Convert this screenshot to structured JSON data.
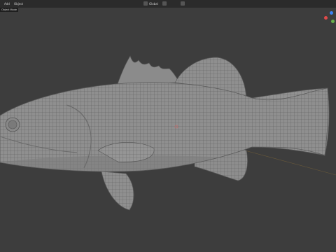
{
  "header": {
    "menu": [
      "Add",
      "Object"
    ],
    "shading_label": "Global",
    "mode_label": "Object Mode"
  },
  "colors": {
    "background": "#3d3d3d",
    "header": "#2b2b2b",
    "mesh": "#8f8f8f",
    "wire": "#5a5a5a",
    "axis_x": "#e04a4a",
    "axis_y": "#6ab04c",
    "axis_z": "#3b82f6"
  },
  "icons": [
    "view-icon",
    "shading-icon",
    "overlay-icon",
    "gizmo-icon"
  ]
}
